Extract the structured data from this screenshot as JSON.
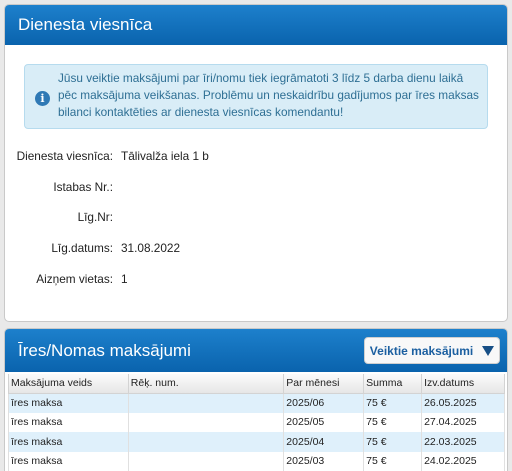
{
  "dormitory_panel": {
    "title": "Dienesta viesnīca",
    "info_text": "Jūsu veiktie maksājumi par īri/nomu tiek iegrāmatoti 3 līdz 5 darba dienu laikā pēc maksājuma veikšanas. Problēmu un neskaidrību gadījumos par īres maksas bilanci kontaktēties ar dienesta viesnīcas komendantu!",
    "fields": [
      {
        "label": "Dienesta viesnīca:",
        "value": "Tālivalža iela 1 b"
      },
      {
        "label": "Istabas Nr.:",
        "value": ""
      },
      {
        "label": "Līg.Nr:",
        "value": ""
      },
      {
        "label": "Līg.datums:",
        "value": "31.08.2022"
      },
      {
        "label": "Aizņem vietas:",
        "value": "1"
      }
    ]
  },
  "payments_panel": {
    "title": "Īres/Nomas maksājumi",
    "dropdown_label": "Veiktie maksājumi",
    "columns": [
      "Maksājuma veids",
      "Rēķ. num.",
      "Par mēnesi",
      "Summa",
      "Izv.datums"
    ],
    "rows": [
      [
        "īres maksa",
        "",
        "2025/06",
        "75 €",
        "26.05.2025"
      ],
      [
        "īres maksa",
        "",
        "2025/05",
        "75 €",
        "27.04.2025"
      ],
      [
        "īres maksa",
        "",
        "2025/04",
        "75 €",
        "22.03.2025"
      ],
      [
        "īres maksa",
        "",
        "2025/03",
        "75 €",
        "24.02.2025"
      ]
    ]
  }
}
